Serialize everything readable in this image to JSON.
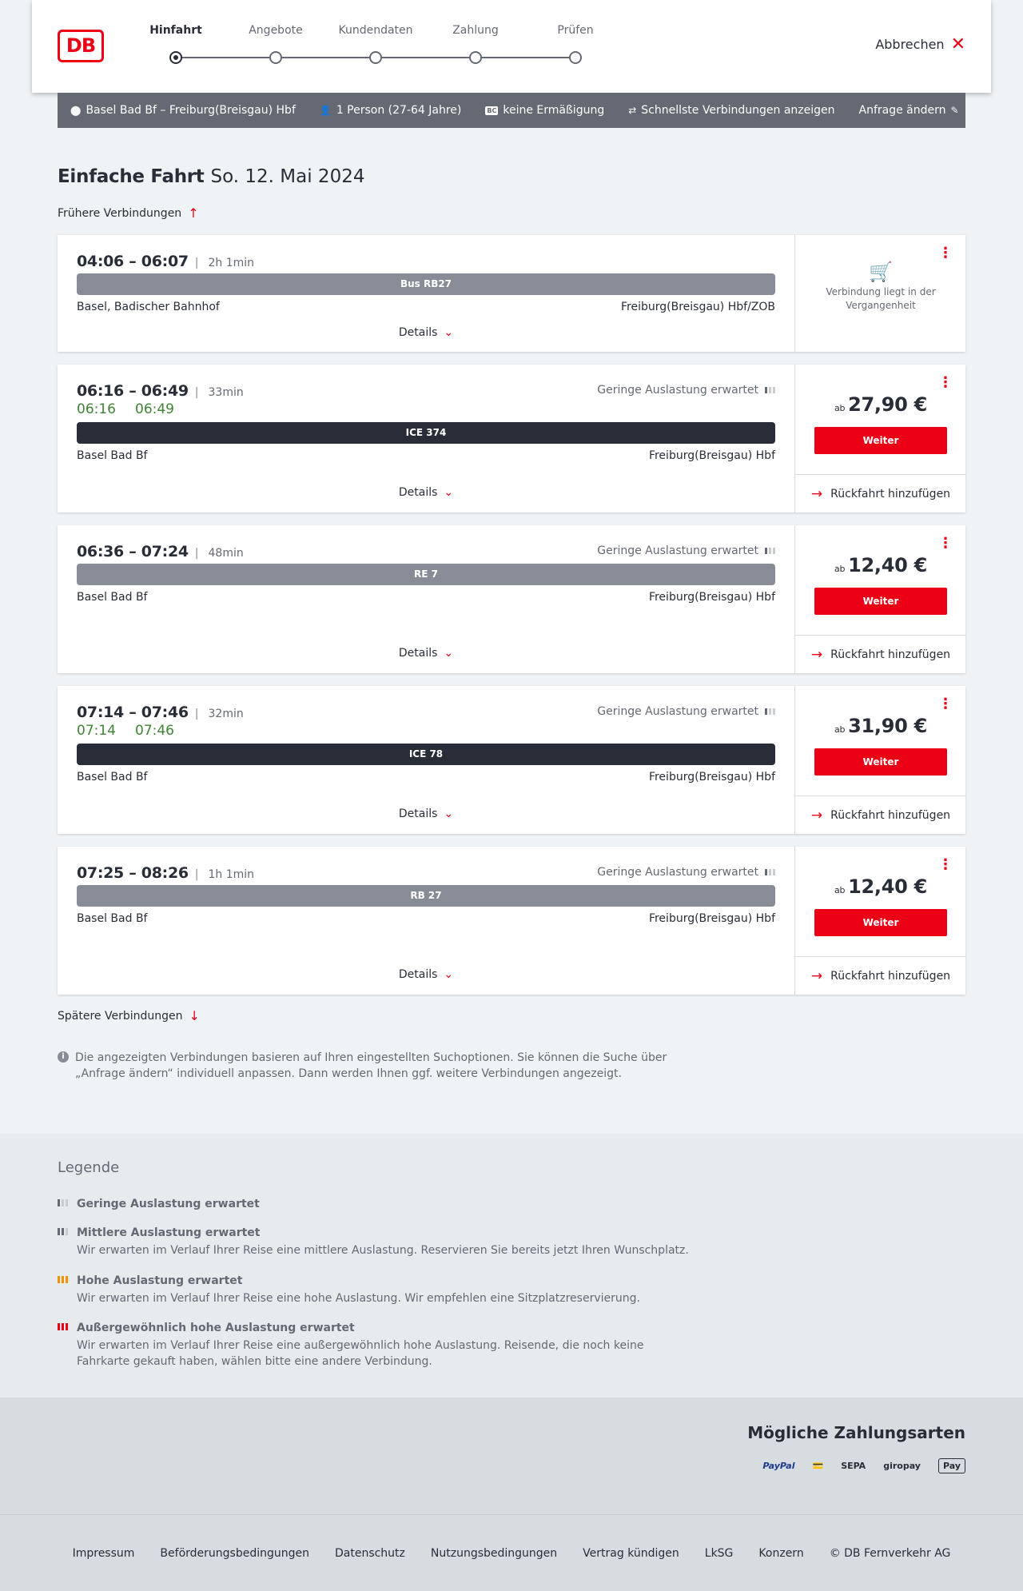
{
  "header": {
    "logo": "DB",
    "steps": [
      "Hinfahrt",
      "Angebote",
      "Kundendaten",
      "Zahlung",
      "Prüfen"
    ],
    "cancel": "Abbrechen"
  },
  "search_summary": {
    "route": "Basel Bad Bf – Freiburg(Breisgau) Hbf",
    "passengers": "1 Person (27-64 Jahre)",
    "bc_badge": "BC",
    "discount": "keine Ermäßigung",
    "mode": "Schnellste Verbindungen anzeigen",
    "change": "Anfrage ändern"
  },
  "main": {
    "title": "Einfache Fahrt",
    "date": "So. 12. Mai 2024",
    "earlier": "Frühere Verbindungen",
    "later": "Spätere Verbindungen",
    "details_label": "Details",
    "continue_label": "Weiter",
    "return_label": "Rückfahrt hinzufügen",
    "price_prefix": "ab",
    "load_label": "Geringe Auslastung erwartet",
    "past_text": "Verbindung liegt in der Vergangenheit"
  },
  "connections": [
    {
      "times": "04:06 – 06:07",
      "duration": "2h 1min",
      "train": "Bus RB27",
      "from": "Basel, Badischer Bahnhof",
      "to": "Freiburg(Breisgau) Hbf/ZOB"
    },
    {
      "times": "06:16 – 06:49",
      "duration": "33min",
      "rt_dep": "06:16",
      "rt_arr": "06:49",
      "train": "ICE 374",
      "from": "Basel Bad Bf",
      "to": "Freiburg(Breisgau) Hbf",
      "price": "27,90 €"
    },
    {
      "times": "06:36 – 07:24",
      "duration": "48min",
      "train": "RE 7",
      "from": "Basel Bad Bf",
      "to": "Freiburg(Breisgau) Hbf",
      "price": "12,40 €"
    },
    {
      "times": "07:14 – 07:46",
      "duration": "32min",
      "rt_dep": "07:14",
      "rt_arr": "07:46",
      "train": "ICE 78",
      "from": "Basel Bad Bf",
      "to": "Freiburg(Breisgau) Hbf",
      "price": "31,90 €"
    },
    {
      "times": "07:25 – 08:26",
      "duration": "1h 1min",
      "train": "RB 27",
      "from": "Basel Bad Bf",
      "to": "Freiburg(Breisgau) Hbf",
      "price": "12,40 €"
    }
  ],
  "info": "Die angezeigten Verbindungen basieren auf Ihren eingestellten Suchoptionen. Sie können die Suche über „Anfrage ändern“ individuell anpassen. Dann werden Ihnen ggf. weitere Verbindungen angezeigt.",
  "legend": {
    "title": "Legende",
    "items": [
      {
        "title": "Geringe Auslastung erwartet",
        "text": ""
      },
      {
        "title": "Mittlere Auslastung erwartet",
        "text": "Wir erwarten im Verlauf Ihrer Reise eine mittlere Auslastung. Reservieren Sie bereits jetzt Ihren Wunschplatz."
      },
      {
        "title": "Hohe Auslastung erwartet",
        "text": "Wir erwarten im Verlauf Ihrer Reise eine hohe Auslastung. Wir empfehlen eine Sitzplatzreservierung."
      },
      {
        "title": "Außergewöhnlich hohe Auslastung erwartet",
        "text": "Wir erwarten im Verlauf Ihrer Reise eine außergewöhnlich hohe Auslastung. Reisende, die noch keine Fahrkarte gekauft haben, wählen bitte eine andere Verbindung."
      }
    ]
  },
  "payment": {
    "title": "Mögliche Zahlungsarten",
    "methods": [
      "PayPal",
      "SEPA",
      "giropay",
      "Pay"
    ]
  },
  "footer": [
    "Impressum",
    "Beförderungsbedingungen",
    "Datenschutz",
    "Nutzungsbedingungen",
    "Vertrag kündigen",
    "LkSG",
    "Konzern",
    "© DB Fernverkehr AG"
  ],
  "colors": {
    "brand_red": "#ec0016",
    "dark": "#282d37",
    "grey_train": "#878c96",
    "realtime_green": "#408335",
    "high_load": "#f39200"
  }
}
